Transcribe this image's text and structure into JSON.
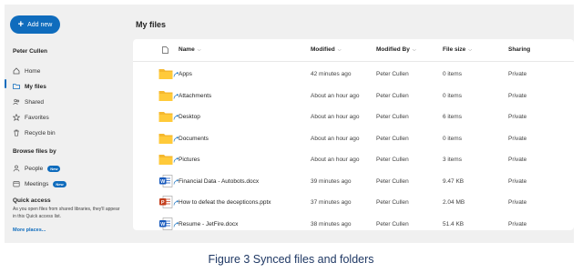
{
  "sidebar": {
    "new_button": "Add new",
    "user_name": "Peter Cullen",
    "nav": [
      {
        "label": "Home",
        "icon": "home-icon"
      },
      {
        "label": "My files",
        "icon": "folder-icon"
      },
      {
        "label": "Shared",
        "icon": "people-icon"
      },
      {
        "label": "Favorites",
        "icon": "star-icon"
      },
      {
        "label": "Recycle bin",
        "icon": "trash-icon"
      }
    ],
    "browse_title": "Browse files by",
    "browse": [
      {
        "label": "People",
        "badge": "New",
        "icon": "person-icon"
      },
      {
        "label": "Meetings",
        "badge": "New",
        "icon": "meetings-icon"
      }
    ],
    "quick_access_title": "Quick access",
    "quick_access_text": "As you open files from shared libraries, they'll appear in this Quick access list.",
    "more_places": "More places..."
  },
  "main": {
    "title": "My files",
    "columns": {
      "name": "Name",
      "modified": "Modified",
      "modified_by": "Modified By",
      "file_size": "File size",
      "sharing": "Sharing"
    },
    "rows": [
      {
        "name": "Apps",
        "type": "folder",
        "modified": "42 minutes ago",
        "modified_by": "Peter Cullen",
        "size": "0 items",
        "sharing": "Private"
      },
      {
        "name": "Attachments",
        "type": "folder",
        "modified": "About an hour ago",
        "modified_by": "Peter Cullen",
        "size": "0 items",
        "sharing": "Private"
      },
      {
        "name": "Desktop",
        "type": "folder",
        "modified": "About an hour ago",
        "modified_by": "Peter Cullen",
        "size": "6 items",
        "sharing": "Private"
      },
      {
        "name": "Documents",
        "type": "folder",
        "modified": "About an hour ago",
        "modified_by": "Peter Cullen",
        "size": "0 items",
        "sharing": "Private"
      },
      {
        "name": "Pictures",
        "type": "folder",
        "modified": "About an hour ago",
        "modified_by": "Peter Cullen",
        "size": "3 items",
        "sharing": "Private"
      },
      {
        "name": "Financial Data - Autobots.docx",
        "type": "docx",
        "modified": "39 minutes ago",
        "modified_by": "Peter Cullen",
        "size": "9.47 KB",
        "sharing": "Private"
      },
      {
        "name": "How to defeat the decepticons.pptx",
        "type": "pptx",
        "modified": "37 minutes ago",
        "modified_by": "Peter Cullen",
        "size": "2.04 MB",
        "sharing": "Private"
      },
      {
        "name": "Resume - JetFire.docx",
        "type": "docx",
        "modified": "38 minutes ago",
        "modified_by": "Peter Cullen",
        "size": "51.4 KB",
        "sharing": "Private"
      }
    ]
  },
  "caption": "Figure 3 Synced files and folders",
  "colors": {
    "accent": "#0f6cbd",
    "folder": "#f5b82e",
    "word": "#185abd",
    "powerpoint": "#c43e1c",
    "sidebar_bg": "#f0f0f0"
  }
}
